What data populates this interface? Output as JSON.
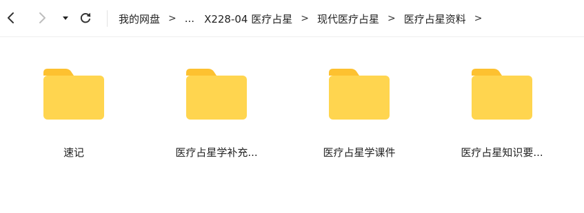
{
  "toolbar": {
    "back_icon": "chevron-left-icon",
    "forward_icon": "chevron-right-icon",
    "history_icon": "caret-down-icon",
    "refresh_icon": "refresh-icon"
  },
  "breadcrumb": {
    "items": [
      "我的网盘",
      "...",
      "X228-04 医疗占星",
      "现代医疗占星",
      "医疗占星资料"
    ],
    "separator": ">"
  },
  "folders": [
    {
      "name": "速记",
      "icon": "folder-icon"
    },
    {
      "name": "医疗占星学补充...",
      "icon": "folder-icon"
    },
    {
      "name": "医疗占星学课件",
      "icon": "folder-icon"
    },
    {
      "name": "医疗占星知识要...",
      "icon": "folder-icon"
    }
  ],
  "colors": {
    "folder_body": "#FFD54F",
    "folder_tab": "#FDC130",
    "nav_active": "#333333",
    "nav_disabled": "#BDBDBD"
  }
}
